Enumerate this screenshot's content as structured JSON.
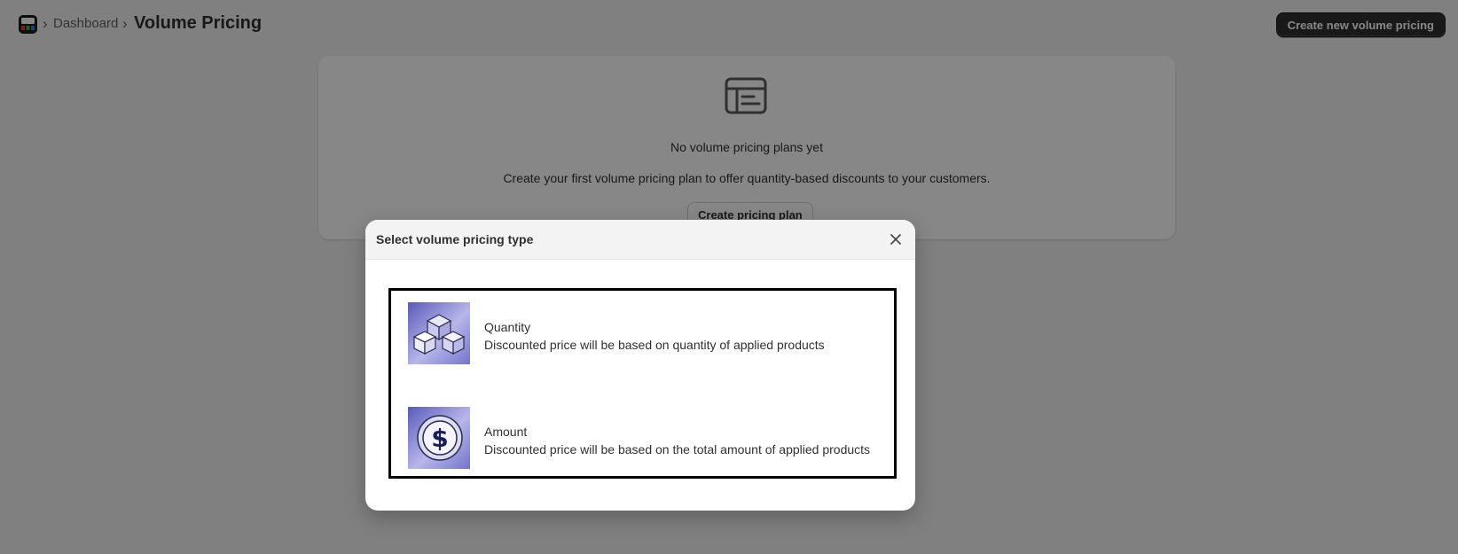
{
  "breadcrumb": {
    "parent": "Dashboard",
    "current": "Volume Pricing"
  },
  "header": {
    "primary_action": "Create new volume pricing"
  },
  "empty_state": {
    "icon": "layout-list-icon",
    "heading": "No volume pricing plans yet",
    "description": "Create your first volume pricing plan to offer quantity-based discounts to your customers.",
    "action": "Create pricing plan"
  },
  "modal": {
    "title": "Select volume pricing type",
    "close_icon": "close-icon",
    "options": [
      {
        "title": "Quantity",
        "description": "Discounted price will be based on quantity of applied products",
        "icon": "cubes-icon"
      },
      {
        "title": "Amount",
        "description": "Discounted price will be based on the total amount of applied products",
        "icon": "dollar-coin-icon"
      }
    ]
  },
  "colors": {
    "primary_button": "#303030",
    "overlay": "rgba(0,0,0,0.47)",
    "option_thumb_accent": "#6f6fc9"
  }
}
